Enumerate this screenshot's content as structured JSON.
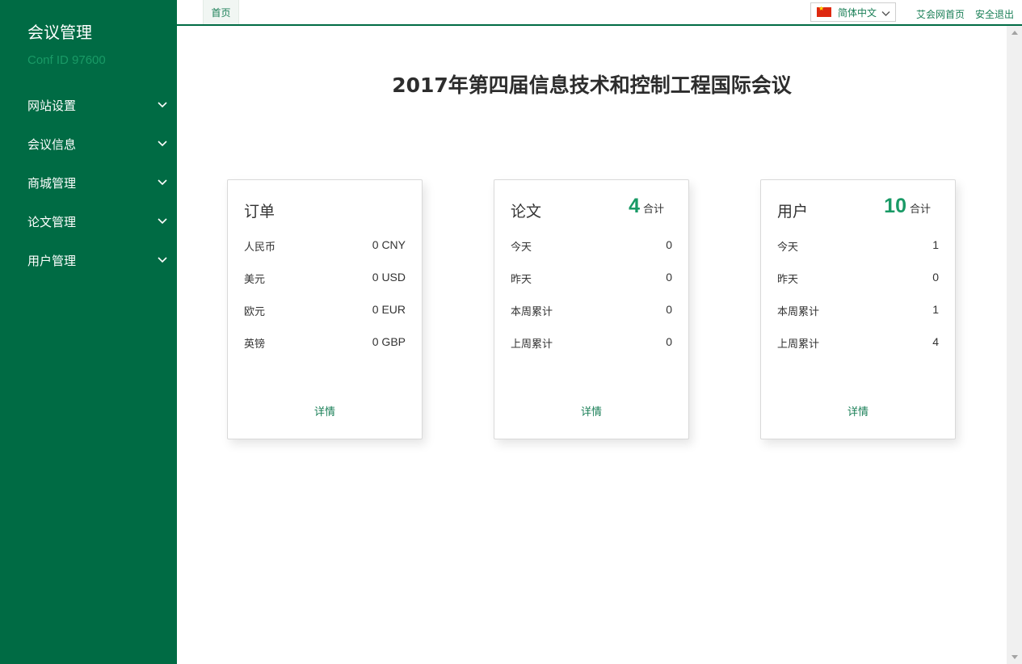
{
  "sidebar": {
    "title": "会议管理",
    "conf_id": "Conf ID 97600",
    "items": [
      {
        "label": "网站设置"
      },
      {
        "label": "会议信息"
      },
      {
        "label": "商城管理"
      },
      {
        "label": "论文管理"
      },
      {
        "label": "用户管理"
      }
    ]
  },
  "topbar": {
    "home_tab": "首页",
    "language": "简体中文",
    "links": [
      "艾会网首页",
      "安全退出"
    ]
  },
  "main": {
    "title": "2017年第四届信息技术和控制工程国际会议",
    "cards": [
      {
        "title": "订单",
        "rows": [
          {
            "label": "人民币",
            "value": "0 CNY"
          },
          {
            "label": "美元",
            "value": "0 USD"
          },
          {
            "label": "欧元",
            "value": "0 EUR"
          },
          {
            "label": "英镑",
            "value": "0 GBP"
          }
        ],
        "link": "详情"
      },
      {
        "title": "论文",
        "total": "4",
        "total_unit": "合计",
        "rows": [
          {
            "label": "今天",
            "value": "0"
          },
          {
            "label": "昨天",
            "value": "0"
          },
          {
            "label": "本周累计",
            "value": "0"
          },
          {
            "label": "上周累计",
            "value": "0"
          }
        ],
        "link": "详情"
      },
      {
        "title": "用户",
        "total": "10",
        "total_unit": "合计",
        "rows": [
          {
            "label": "今天",
            "value": "1"
          },
          {
            "label": "昨天",
            "value": "0"
          },
          {
            "label": "本周累计",
            "value": "1"
          },
          {
            "label": "上周累计",
            "value": "4"
          }
        ],
        "link": "详情"
      }
    ]
  },
  "colors": {
    "sidebar_bg": "#006b44",
    "accent": "#199a66",
    "link": "#1a7f57"
  },
  "icons": {
    "sidebar_chevron": "chevron-down-icon",
    "language_flag": "china-flag-icon",
    "language_chevron": "chevron-down-icon"
  }
}
